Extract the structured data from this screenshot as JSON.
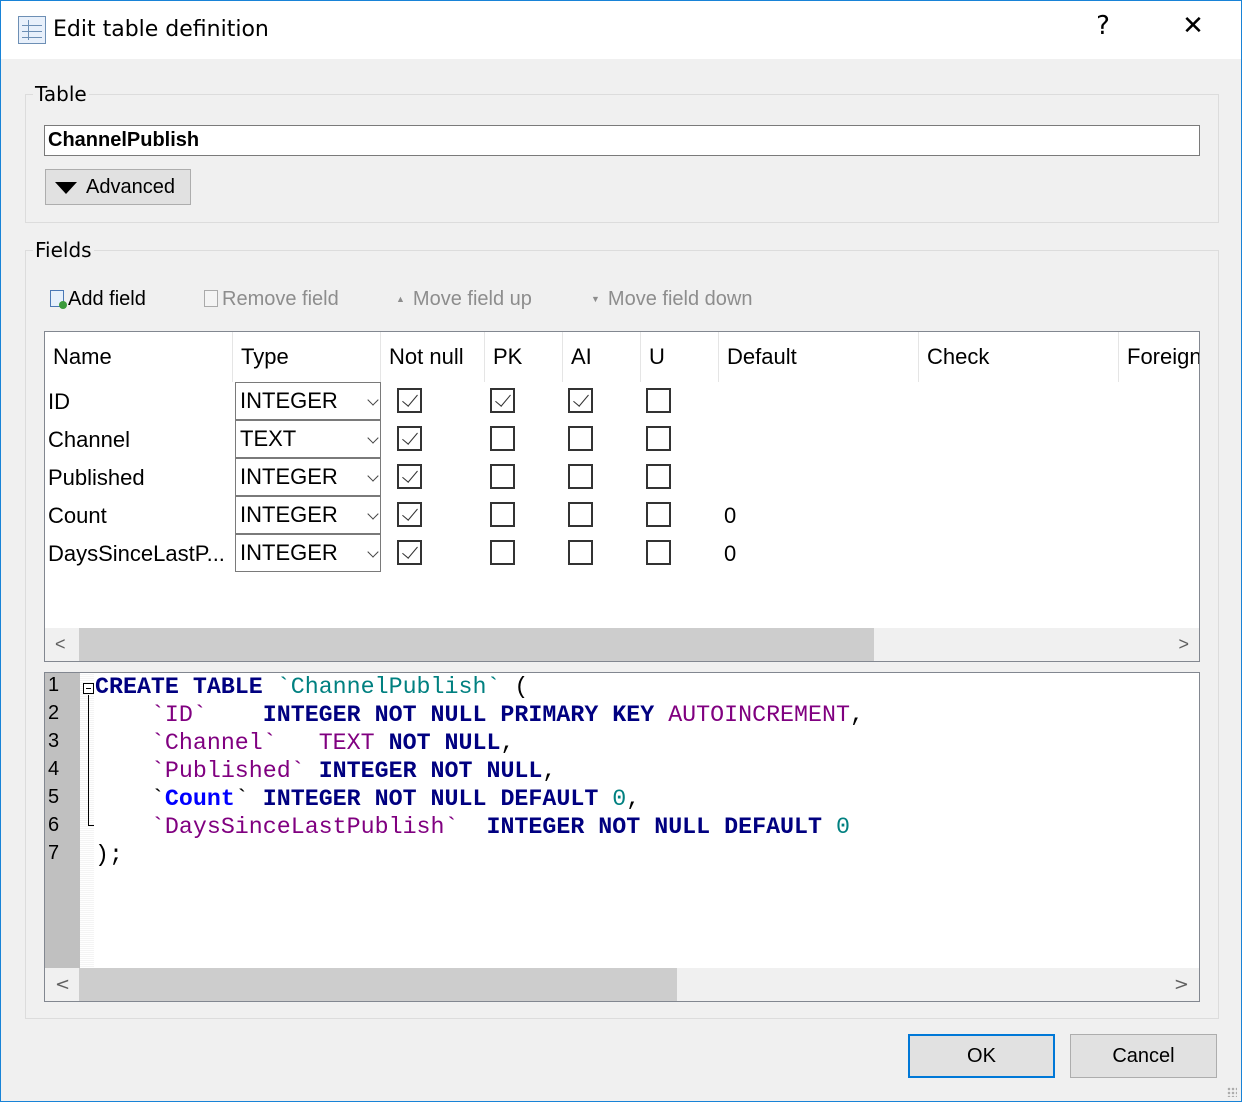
{
  "window": {
    "title": "Edit table definition",
    "help": "?",
    "close": "✕",
    "accent": "#0078d7"
  },
  "table_group": {
    "label": "Table",
    "name_value": "ChannelPublish",
    "advanced_label": "Advanced"
  },
  "fields_group": {
    "label": "Fields",
    "toolbar": {
      "add": "Add field",
      "remove": "Remove field",
      "up": "Move field up",
      "down": "Move field down"
    },
    "columns": [
      "Name",
      "Type",
      "Not null",
      "PK",
      "AI",
      "U",
      "Default",
      "Check",
      "Foreign Key"
    ],
    "rows": [
      {
        "name": "ID",
        "type": "INTEGER",
        "not_null": true,
        "pk": true,
        "ai": true,
        "u": false,
        "default": ""
      },
      {
        "name": "Channel",
        "type": "TEXT",
        "not_null": true,
        "pk": false,
        "ai": false,
        "u": false,
        "default": ""
      },
      {
        "name": "Published",
        "type": "INTEGER",
        "not_null": true,
        "pk": false,
        "ai": false,
        "u": false,
        "default": ""
      },
      {
        "name": "Count",
        "type": "INTEGER",
        "not_null": true,
        "pk": false,
        "ai": false,
        "u": false,
        "default": "0"
      },
      {
        "name": "DaysSinceLastP...",
        "type": "INTEGER",
        "not_null": true,
        "pk": false,
        "ai": false,
        "u": false,
        "default": "0"
      }
    ]
  },
  "sql": {
    "line_numbers": [
      "1",
      "2",
      "3",
      "4",
      "5",
      "6",
      "7"
    ],
    "lines": [
      [
        {
          "t": "CREATE TABLE ",
          "c": "kw"
        },
        {
          "t": "`ChannelPublish`",
          "c": "tbl"
        },
        {
          "t": " (",
          "c": "p"
        }
      ],
      [
        {
          "t": "    ",
          "c": "p"
        },
        {
          "t": "`ID`",
          "c": "id"
        },
        {
          "t": "    ",
          "c": "p"
        },
        {
          "t": "INTEGER NOT NULL PRIMARY KEY ",
          "c": "kw"
        },
        {
          "t": "AUTOINCREMENT",
          "c": "id"
        },
        {
          "t": ",",
          "c": "p"
        }
      ],
      [
        {
          "t": "    ",
          "c": "p"
        },
        {
          "t": "`Channel`",
          "c": "id"
        },
        {
          "t": "   ",
          "c": "p"
        },
        {
          "t": "TEXT",
          "c": "id"
        },
        {
          "t": " NOT NULL",
          "c": "kw"
        },
        {
          "t": ",",
          "c": "p"
        }
      ],
      [
        {
          "t": "    ",
          "c": "p"
        },
        {
          "t": "`Published`",
          "c": "id"
        },
        {
          "t": " INTEGER NOT NULL",
          "c": "kw"
        },
        {
          "t": ",",
          "c": "p"
        }
      ],
      [
        {
          "t": "    `",
          "c": "p"
        },
        {
          "t": "Count",
          "c": "hl"
        },
        {
          "t": "`",
          "c": "p"
        },
        {
          "t": " INTEGER NOT NULL DEFAULT ",
          "c": "kw"
        },
        {
          "t": "0",
          "c": "num"
        },
        {
          "t": ",",
          "c": "p"
        }
      ],
      [
        {
          "t": "    ",
          "c": "p"
        },
        {
          "t": "`DaysSinceLastPublish`",
          "c": "id"
        },
        {
          "t": "  INTEGER NOT NULL DEFAULT ",
          "c": "kw"
        },
        {
          "t": "0",
          "c": "num"
        }
      ],
      [
        {
          "t": ");",
          "c": "p"
        }
      ]
    ]
  },
  "buttons": {
    "ok": "OK",
    "cancel": "Cancel"
  }
}
